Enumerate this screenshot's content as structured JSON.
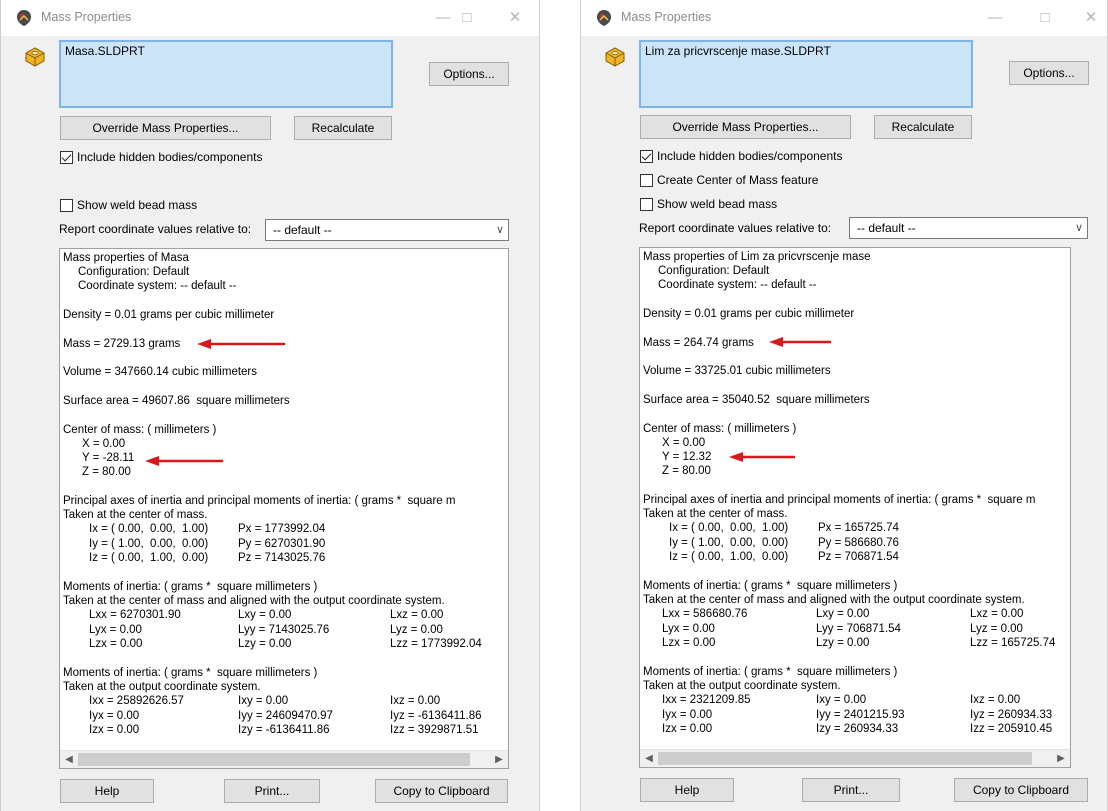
{
  "dialogs": [
    {
      "window_title": "Mass Properties",
      "part_name": "Masa.SLDPRT",
      "options_button": "Options...",
      "override_button": "Override Mass Properties...",
      "recalculate_button": "Recalculate",
      "include_hidden_label": "Include hidden bodies/components",
      "include_hidden_checked": true,
      "show_weld_label": "Show weld bead mass",
      "report_label": "Report coordinate values relative to:",
      "coord_system": "-- default --",
      "results": {
        "heading": "Mass properties of Masa",
        "configuration": "Configuration: Default",
        "coordinate_system": "Coordinate system: -- default --",
        "density": "Density = 0.01 grams per cubic millimeter",
        "mass": "Mass = 2729.13 grams",
        "volume": "Volume = 347660.14 cubic millimeters",
        "surface_area": "Surface area = 49607.86  square millimeters",
        "com_heading": "Center of mass: ( millimeters )",
        "com_x": "X = 0.00",
        "com_y": "Y = -28.11",
        "com_z": "Z = 80.00",
        "principal_heading": "Principal axes of inertia and principal moments of inertia: ( grams *  square m",
        "principal_sub": "Taken at the center of mass.",
        "ix": "Ix = ( 0.00,  0.00,  1.00)",
        "iy": "Iy = ( 1.00,  0.00,  0.00)",
        "iz": "Iz = ( 0.00,  1.00,  0.00)",
        "px": "Px = 1773992.04",
        "py": "Py = 6270301.90",
        "pz": "Pz = 7143025.76",
        "moi_com_heading": "Moments of inertia: ( grams *  square millimeters )",
        "moi_com_sub": "Taken at the center of mass and aligned with the output coordinate system.",
        "lxx": "Lxx = 6270301.90",
        "lxy": "Lxy = 0.00",
        "lxz": "Lxz = 0.00",
        "lyx": "Lyx = 0.00",
        "lyy": "Lyy = 7143025.76",
        "lyz": "Lyz = 0.00",
        "lzx": "Lzx = 0.00",
        "lzy": "Lzy = 0.00",
        "lzz": "Lzz = 1773992.04",
        "moi_out_heading": "Moments of inertia: ( grams *  square millimeters )",
        "moi_out_sub": "Taken at the output coordinate system.",
        "ixx": "Ixx = 25892626.57",
        "ixy": "Ixy = 0.00",
        "ixz": "Ixz = 0.00",
        "iyx": "Iyx = 0.00",
        "iyy": "Iyy = 24609470.97",
        "iyz": "Iyz = -6136411.86",
        "izx": "Izx = 0.00",
        "izy": "Izy = -6136411.86",
        "izz": "Izz = 3929871.51"
      },
      "help_button": "Help",
      "print_button": "Print...",
      "copy_button": "Copy to Clipboard"
    },
    {
      "window_title": "Mass Properties",
      "part_name": "Lim za pricvrscenje mase.SLDPRT",
      "options_button": "Options...",
      "override_button": "Override Mass Properties...",
      "recalculate_button": "Recalculate",
      "include_hidden_label": "Include hidden bodies/components",
      "include_hidden_checked": true,
      "create_com_label": "Create Center of Mass feature",
      "show_weld_label": "Show weld bead mass",
      "report_label": "Report coordinate values relative to:",
      "coord_system": "-- default --",
      "results": {
        "heading": "Mass properties of Lim za pricvrscenje mase",
        "configuration": "Configuration: Default",
        "coordinate_system": "Coordinate system: -- default --",
        "density": "Density = 0.01 grams per cubic millimeter",
        "mass": "Mass = 264.74 grams",
        "volume": "Volume = 33725.01 cubic millimeters",
        "surface_area": "Surface area = 35040.52  square millimeters",
        "com_heading": "Center of mass: ( millimeters )",
        "com_x": "X = 0.00",
        "com_y": "Y = 12.32",
        "com_z": "Z = 80.00",
        "principal_heading": "Principal axes of inertia and principal moments of inertia: ( grams *  square m",
        "principal_sub": "Taken at the center of mass.",
        "ix": "Ix = ( 0.00,  0.00,  1.00)",
        "iy": "Iy = ( 1.00,  0.00,  0.00)",
        "iz": "Iz = ( 0.00,  1.00,  0.00)",
        "px": "Px = 165725.74",
        "py": "Py = 586680.76",
        "pz": "Pz = 706871.54",
        "moi_com_heading": "Moments of inertia: ( grams *  square millimeters )",
        "moi_com_sub": "Taken at the center of mass and aligned with the output coordinate system.",
        "lxx": "Lxx = 586680.76",
        "lxy": "Lxy = 0.00",
        "lxz": "Lxz = 0.00",
        "lyx": "Lyx = 0.00",
        "lyy": "Lyy = 706871.54",
        "lyz": "Lyz = 0.00",
        "lzx": "Lzx = 0.00",
        "lzy": "Lzy = 0.00",
        "lzz": "Lzz = 165725.74",
        "moi_out_heading": "Moments of inertia: ( grams *  square millimeters )",
        "moi_out_sub": "Taken at the output coordinate system.",
        "ixx": "Ixx = 2321209.85",
        "ixy": "Ixy = 0.00",
        "ixz": "Ixz = 0.00",
        "iyx": "Iyx = 0.00",
        "iyy": "Iyy = 2401215.93",
        "iyz": "Iyz = 260934.33",
        "izx": "Izx = 0.00",
        "izy": "Izy = 260934.33",
        "izz": "Izz = 205910.45"
      },
      "help_button": "Help",
      "print_button": "Print...",
      "copy_button": "Copy to Clipboard"
    }
  ],
  "colors": {
    "highlight_arrow": "#d7191c",
    "name_box_fill": "#cce4f7",
    "name_box_border": "#7eb4ea"
  },
  "icons": [
    "app-logo-icon",
    "part-icon",
    "minimize-icon",
    "maximize-icon",
    "close-icon",
    "chevron-down-icon",
    "arrow-left-icon",
    "arrow-right-icon",
    "red-arrow-icon"
  ]
}
